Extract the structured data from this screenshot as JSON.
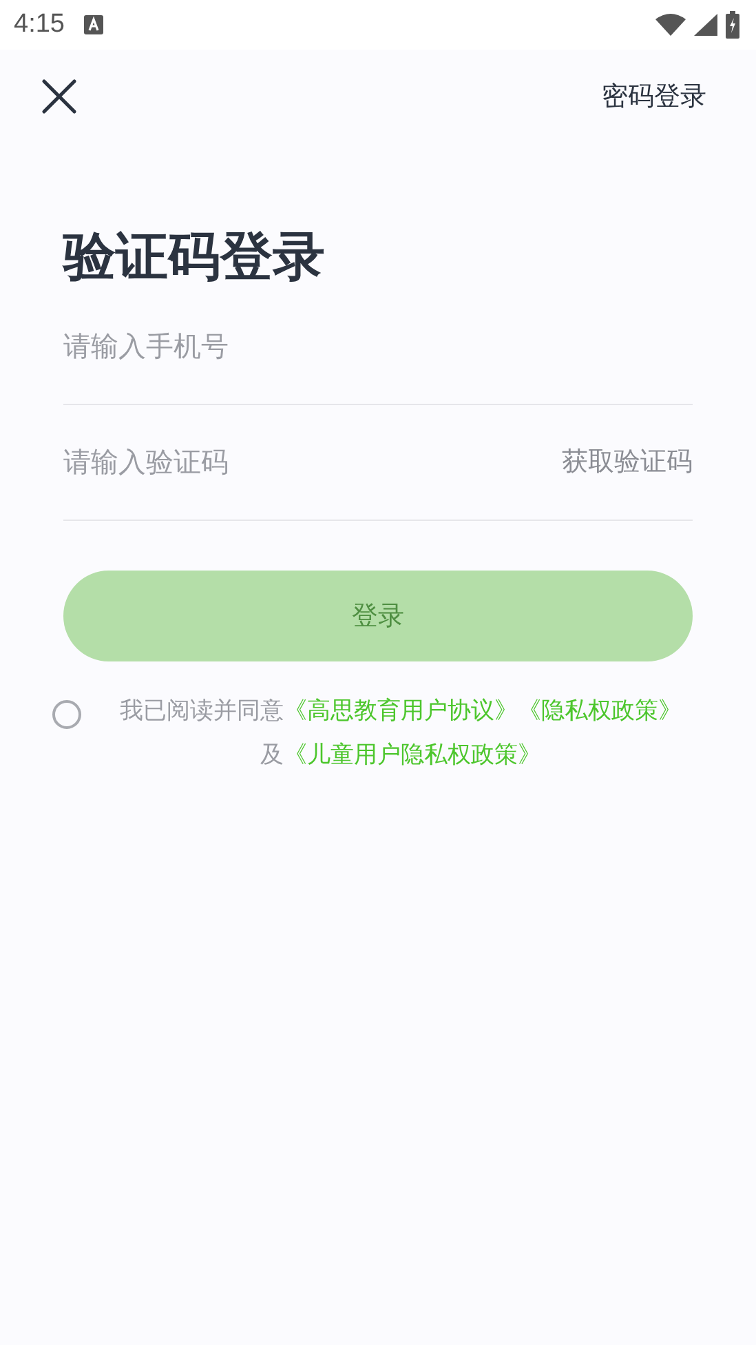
{
  "status_bar": {
    "time": "4:15"
  },
  "header": {
    "switch_link": "密码登录"
  },
  "title": "验证码登录",
  "phone_field": {
    "placeholder": "请输入手机号"
  },
  "code_field": {
    "placeholder": "请输入验证码",
    "action": "获取验证码"
  },
  "login_button": {
    "label": "登录",
    "disabled": true
  },
  "agreement": {
    "checked": false,
    "lines": [
      [
        {
          "kind": "text",
          "text": "我已阅读并同意"
        },
        {
          "kind": "link",
          "text": "《高思教育用户协议》"
        },
        {
          "kind": "link",
          "text": "《隐私权政策》"
        }
      ],
      [
        {
          "kind": "text",
          "text": "及"
        },
        {
          "kind": "link",
          "text": "《儿童用户隐私权政策》"
        }
      ]
    ]
  }
}
